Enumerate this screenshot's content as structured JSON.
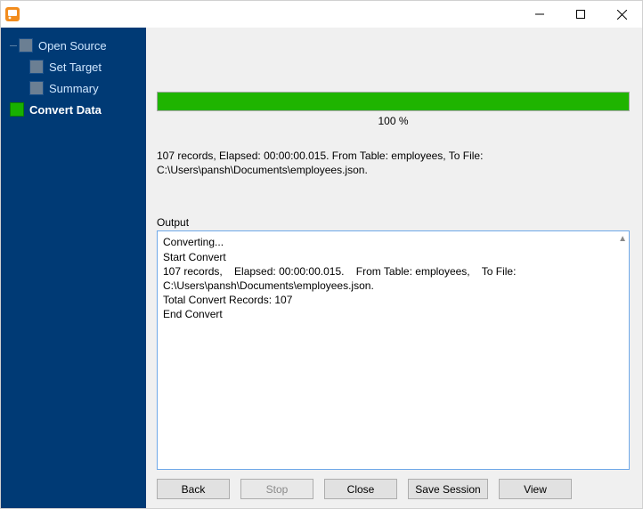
{
  "titlebar": {
    "title": ""
  },
  "sidebar": {
    "items": [
      {
        "label": "Open Source",
        "active": false
      },
      {
        "label": "Set Target",
        "active": false
      },
      {
        "label": "Summary",
        "active": false
      },
      {
        "label": "Convert Data",
        "active": true
      }
    ]
  },
  "progress": {
    "percent_text": "100 %",
    "percent": 100
  },
  "status": {
    "line": "107 records,    Elapsed: 00:00:00.015.    From Table: employees,    To File: C:\\Users\\pansh\\Documents\\employees.json."
  },
  "output": {
    "label": "Output",
    "text": "Converting...\nStart Convert\n107 records,    Elapsed: 00:00:00.015.    From Table: employees,    To File: C:\\Users\\pansh\\Documents\\employees.json.\nTotal Convert Records: 107\nEnd Convert\n"
  },
  "buttons": {
    "back": "Back",
    "stop": "Stop",
    "close": "Close",
    "save_session": "Save Session",
    "view": "View"
  }
}
